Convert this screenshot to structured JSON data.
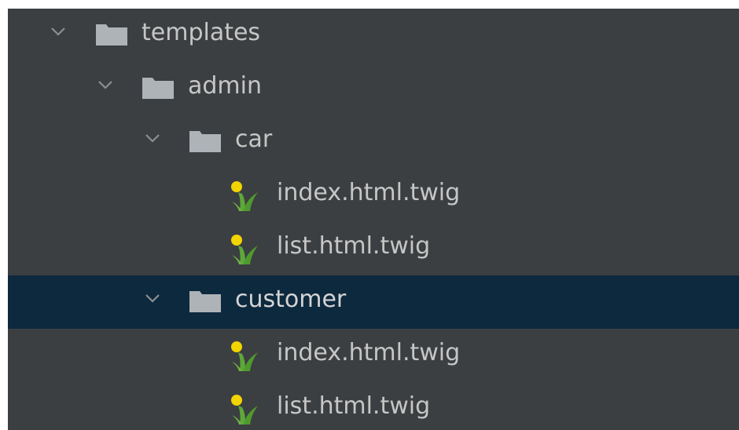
{
  "tree": {
    "items": [
      {
        "label": "templates",
        "type": "folder",
        "expanded": true,
        "selected": false
      },
      {
        "label": "admin",
        "type": "folder",
        "expanded": true,
        "selected": false
      },
      {
        "label": "car",
        "type": "folder",
        "expanded": true,
        "selected": false
      },
      {
        "label": "index.html.twig",
        "type": "twig-file",
        "selected": false
      },
      {
        "label": "list.html.twig",
        "type": "twig-file",
        "selected": false
      },
      {
        "label": "customer",
        "type": "folder",
        "expanded": true,
        "selected": true
      },
      {
        "label": "index.html.twig",
        "type": "twig-file",
        "selected": false
      },
      {
        "label": "list.html.twig",
        "type": "twig-file",
        "selected": false
      }
    ]
  },
  "colors": {
    "panel_background": "#3c3f41",
    "selection_background": "#0d293e",
    "text": "#bbbbbb",
    "folder_icon": "#aeb3b8",
    "chevron": "#8c8f92"
  },
  "icons": {
    "folder": "folder-icon",
    "twig": "twig-file-icon",
    "expanded": "chevron-down-icon"
  }
}
